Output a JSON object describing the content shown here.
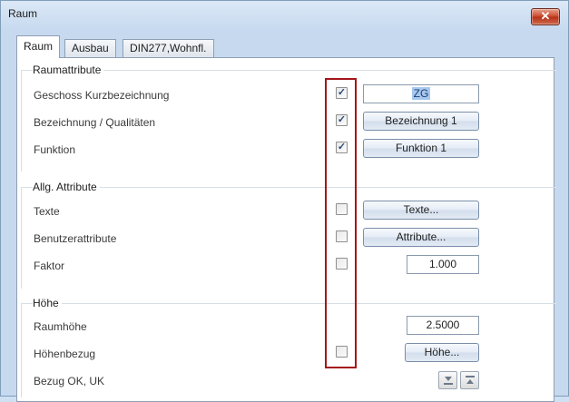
{
  "window": {
    "title": "Raum",
    "close_glyph": "✕"
  },
  "tabs": [
    {
      "label": "Raum",
      "active": true
    },
    {
      "label": "Ausbau",
      "active": false
    },
    {
      "label": "DIN277,Wohnfl.",
      "active": false
    }
  ],
  "groups": {
    "raumattribute": {
      "title": "Raumattribute",
      "rows": [
        {
          "label": "Geschoss Kurzbezeichnung",
          "checked": true,
          "field_value": "ZG"
        },
        {
          "label": "Bezeichnung / Qualitäten",
          "checked": true,
          "button_label": "Bezeichnung 1"
        },
        {
          "label": "Funktion",
          "checked": true,
          "button_label": "Funktion 1"
        }
      ]
    },
    "allg": {
      "title": "Allg. Attribute",
      "rows": [
        {
          "label": "Texte",
          "checked": false,
          "button_label": "Texte..."
        },
        {
          "label": "Benutzerattribute",
          "checked": false,
          "button_label": "Attribute..."
        },
        {
          "label": "Faktor",
          "checked": false,
          "field_value": "1.000"
        }
      ]
    },
    "hoehe": {
      "title": "Höhe",
      "rows": [
        {
          "label": "Raumhöhe",
          "field_value": "2.5000"
        },
        {
          "label": "Höhenbezug",
          "checked": false,
          "button_label": "Höhe..."
        },
        {
          "label": "Bezug OK, UK",
          "icons": [
            "align-bottom-icon",
            "align-top-icon"
          ]
        }
      ]
    }
  },
  "colors": {
    "highlight_border": "#a4161a",
    "selection": "#a7c8ee"
  }
}
